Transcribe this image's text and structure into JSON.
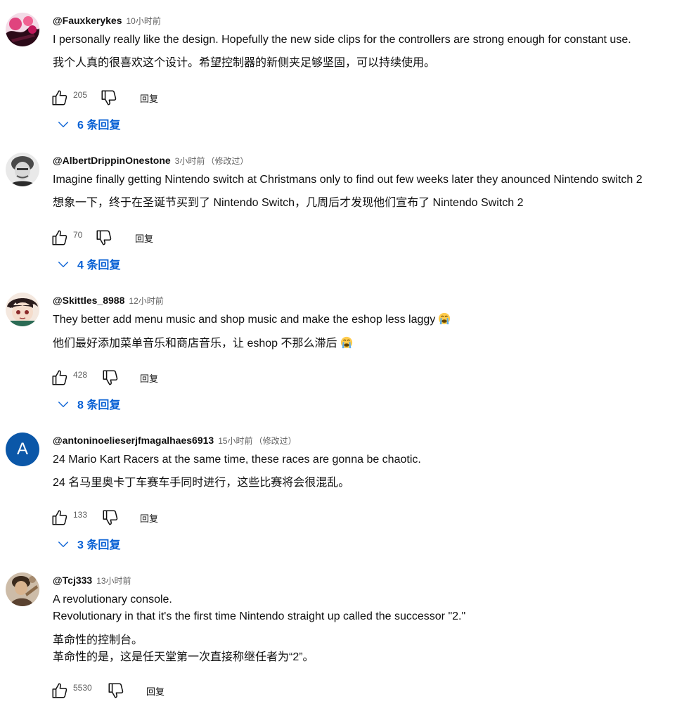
{
  "comments": [
    {
      "author": "@Fauxkerykes",
      "time": "10小时前",
      "edited": "",
      "text": [
        "I personally really like the design. Hopefully the new side clips for the controllers are strong enough for constant use."
      ],
      "translation": [
        "我个人真的很喜欢这个设计。希望控制器的新侧夹足够坚固，可以持续使用。"
      ],
      "likes": "205",
      "reply_label": "回复",
      "replies_label": "6 条回复",
      "avatar_colors": [
        "#f2d9e6",
        "#2b0a18",
        "#e0447e"
      ]
    },
    {
      "author": "@AlbertDrippinOnestone",
      "time": "3小时前",
      "edited": "（修改过）",
      "text": [
        "Imagine finally getting Nintendo switch at Christmans only to find out few weeks later they anounced Nintendo switch 2"
      ],
      "translation": [
        "想象一下，终于在圣诞节买到了 Nintendo Switch，几周后才发现他们宣布了 Nintendo Switch 2"
      ],
      "likes": "70",
      "reply_label": "回复",
      "replies_label": "4 条回复",
      "avatar_colors": [
        "#e6e6e6",
        "#3a3a3a",
        "#8c8c8c"
      ]
    },
    {
      "author": "@Skittles_8988",
      "time": "12小时前",
      "edited": "",
      "text": [
        "They better add menu music and shop music and make the eshop less laggy"
      ],
      "translation": [
        "他们最好添加菜单音乐和商店音乐，让 eshop 不那么滞后"
      ],
      "likes": "428",
      "reply_label": "回复",
      "replies_label": "8 条回复",
      "avatar_colors": [
        "#f1e4da",
        "#2a1c1c",
        "#d05a58"
      ]
    },
    {
      "author": "@antoninoelieserjfmagalhaes6913",
      "time": "15小时前",
      "edited": "（修改过）",
      "text": [
        "24 Mario Kart Racers at the same time, these races are gonna be chaotic."
      ],
      "translation": [
        "24 名马里奥卡丁车赛车手同时进行，这些比赛将会很混乱。"
      ],
      "likes": "133",
      "reply_label": "回复",
      "replies_label": "3 条回复",
      "avatar_letter": "A",
      "avatar_colors": [
        "#0b57a8",
        "#ffffff",
        "#0b57a8"
      ]
    },
    {
      "author": "@Tcj333",
      "time": "13小时前",
      "edited": "",
      "text": [
        "A revolutionary console.",
        "Revolutionary in that it's the first time Nintendo straight up called the successor \"2.\""
      ],
      "translation": [
        "革命性的控制台。",
        "革命性的是，这是任天堂第一次直接称继任者为“2”。"
      ],
      "likes": "5530",
      "reply_label": "回复",
      "replies_label": "",
      "avatar_colors": [
        "#c9b7a2",
        "#3b2a1c",
        "#8a6a4a"
      ]
    }
  ],
  "icons": {
    "like": "thumb-up-outline",
    "dislike": "thumb-down-outline",
    "expand": "chevron-down",
    "emoji": "loudly-crying-face"
  },
  "colors": {
    "link_blue": "#065fd4",
    "meta_gray": "#606060",
    "text": "#0f0f0f"
  }
}
